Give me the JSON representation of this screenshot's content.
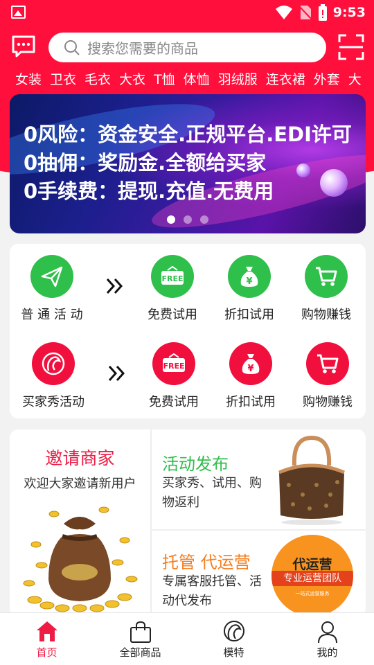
{
  "status_bar": {
    "time": "9:53"
  },
  "search": {
    "placeholder": "搜索您需要的商品"
  },
  "categories": [
    "女装",
    "卫衣",
    "毛衣",
    "大衣",
    "T恤",
    "体恤",
    "羽绒服",
    "连衣裙",
    "外套",
    "大"
  ],
  "banner": {
    "lines": [
      "0风险：资金安全.正规平台.EDI许可",
      "0抽佣：奖励金.全额给买家",
      "0手续费：提现.充值.无费用"
    ],
    "active_dot": 0
  },
  "activities": {
    "row1": {
      "main_label": "普 通 活 动",
      "items": [
        {
          "label": "免费试用",
          "icon": "free-tag-icon"
        },
        {
          "label": "折扣试用",
          "icon": "money-bag-icon"
        },
        {
          "label": "购物赚钱",
          "icon": "shopping-cart-icon"
        }
      ],
      "color": "#2fbf4b"
    },
    "row2": {
      "main_label": "买家秀活动",
      "items": [
        {
          "label": "免费试用",
          "icon": "free-tag-icon"
        },
        {
          "label": "折扣试用",
          "icon": "money-bag-icon"
        },
        {
          "label": "购物赚钱",
          "icon": "shopping-cart-icon"
        }
      ],
      "color": "#f10f3d"
    }
  },
  "promo": {
    "invite": {
      "title": "邀请商家",
      "subtitle": "欢迎大家邀请新用户"
    },
    "publish": {
      "title": "活动发布",
      "subtitle": "买家秀、试用、购物返利"
    },
    "operate": {
      "title": "托管 代运营",
      "subtitle": "专属客服托管、活动代发布"
    },
    "badge": {
      "title": "代运营",
      "ribbon": "专业运营团队",
      "small": "一站式运营服务"
    }
  },
  "nav": [
    {
      "label": "首页",
      "icon": "home-icon",
      "active": true
    },
    {
      "label": "全部商品",
      "icon": "shopping-bag-icon",
      "active": false
    },
    {
      "label": "模特",
      "icon": "model-icon",
      "active": false
    },
    {
      "label": "我的",
      "icon": "user-icon",
      "active": false
    }
  ],
  "colors": {
    "brand": "#ff0f3c",
    "green": "#2fbf4b",
    "orange": "#f57d1f"
  }
}
